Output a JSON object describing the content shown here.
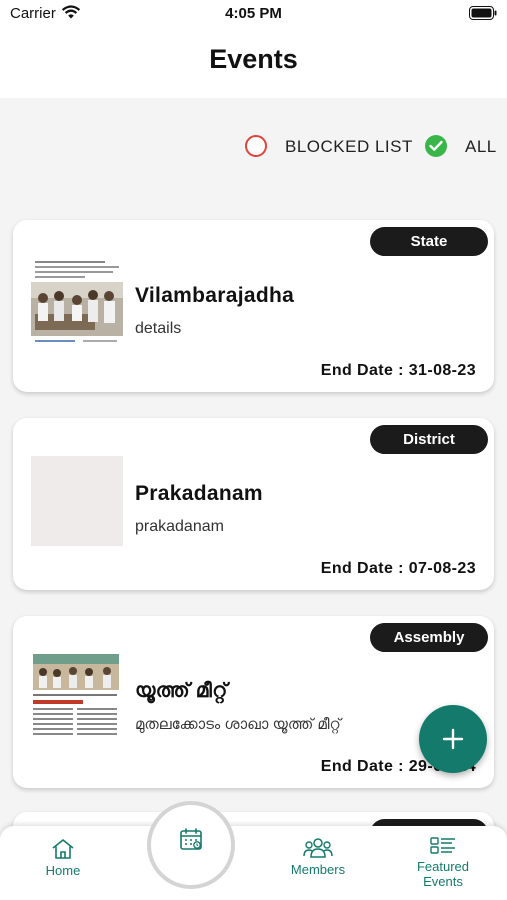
{
  "status_bar": {
    "carrier": "Carrier",
    "time": "4:05 PM"
  },
  "header": {
    "title": "Events"
  },
  "filter": {
    "blocked_label": "BLOCKED LIST",
    "all_label": "ALL",
    "selected": "ALL"
  },
  "events": [
    {
      "badge": "State",
      "title": "Vilambarajadha",
      "description": "details",
      "end_date": "End Date : 31-08-23"
    },
    {
      "badge": "District",
      "title": "Prakadanam",
      "description": "prakadanam",
      "end_date": "End Date : 07-08-23"
    },
    {
      "badge": "Assembly",
      "title": "യൂത്ത് മീറ്റ്",
      "description": "മുതലക്കോടം ശാഖാ യൂത്ത് മീറ്റ്",
      "end_date": "End Date : 29-08-24"
    }
  ],
  "fab": {
    "icon": "plus-icon"
  },
  "tab_bar": {
    "home": "Home",
    "center_icon": "calendar-icon",
    "members": "Members",
    "featured_line1": "Featured",
    "featured_line2": "Events"
  },
  "colors": {
    "accent": "#147a6b",
    "badge_bg": "#1b1b1b",
    "blocked_radio": "#e0443a",
    "all_radio": "#3ab54a"
  }
}
